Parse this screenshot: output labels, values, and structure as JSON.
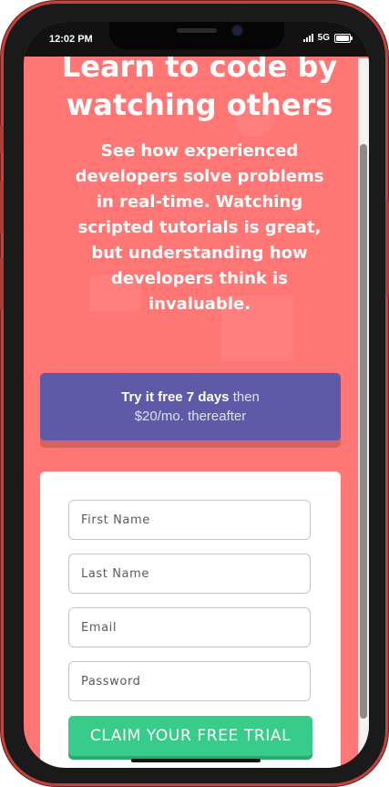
{
  "status": {
    "time": "12:02 PM",
    "network": "5G"
  },
  "hero": {
    "title": "Learn to code by watching others",
    "description": "See how experienced developers solve problems in real-time. Watching scripted tutorials is great, but understanding how developers think is invaluable."
  },
  "promo": {
    "bold": "Try it free 7 days",
    "rest": "then",
    "price": "$20/mo. thereafter"
  },
  "form": {
    "first_name_placeholder": "First Name",
    "last_name_placeholder": "Last Name",
    "email_placeholder": "Email",
    "password_placeholder": "Password",
    "submit_label": "CLAIM YOUR FREE TRIAL"
  },
  "colors": {
    "background": "#ff7675",
    "promo": "#5f5aa8",
    "cta": "#38cc8b"
  }
}
